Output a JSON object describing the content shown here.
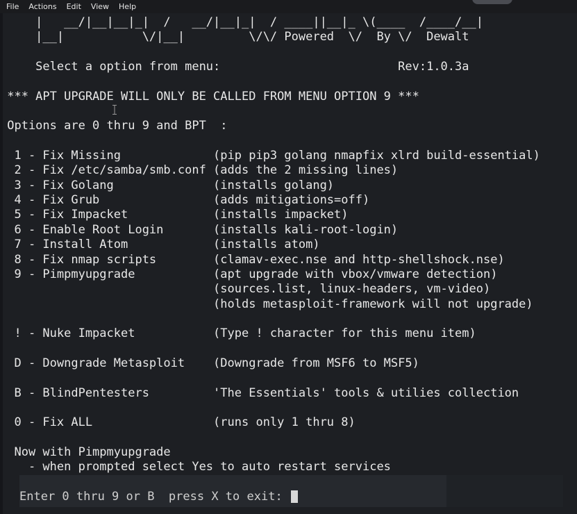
{
  "menubar": {
    "items": [
      {
        "label": "File"
      },
      {
        "label": "Actions"
      },
      {
        "label": "Edit"
      },
      {
        "label": "View"
      },
      {
        "label": "Help"
      }
    ]
  },
  "terminal": {
    "lines": [
      "     |   __/|__|__|_|  /   __/|__|_|  / ____||__|_ \\(____  /____/__|",
      "     |__|           \\/|__|         \\/\\/ Powered  \\/  By \\/  Dewalt",
      "",
      "     Select a option from menu:                         Rev:1.0.3a",
      "",
      " *** APT UPGRADE WILL ONLY BE CALLED FROM MENU OPTION 9 ***",
      "",
      " Options are 0 thru 9 and BPT  :",
      "",
      "  1 - Fix Missing             (pip pip3 golang nmapfix xlrd build-essential)",
      "  2 - Fix /etc/samba/smb.conf (adds the 2 missing lines)",
      "  3 - Fix Golang              (installs golang)",
      "  4 - Fix Grub                (adds mitigations=off)",
      "  5 - Fix Impacket            (installs impacket)",
      "  6 - Enable Root Login       (installs kali-root-login)",
      "  7 - Install Atom            (installs atom)",
      "  8 - Fix nmap scripts        (clamav-exec.nse and http-shellshock.nse)",
      "  9 - Pimpmyupgrade           (apt upgrade with vbox/vmware detection)",
      "                              (sources.list, linux-headers, vm-video)",
      "                              (holds metasploit-framework will not upgrade)",
      "",
      "  ! - Nuke Impacket           (Type ! character for this menu item)",
      "",
      "  D - Downgrade Metasploit    (Downgrade from MSF6 to MSF5)",
      "",
      "  B - BlindPentesters         'The Essentials' tools & utilies collection",
      "",
      "  0 - Fix ALL                 (runs only 1 thru 8)",
      "",
      "  Now with Pimpmyupgrade",
      "    - when prompted select Yes to auto restart services"
    ]
  },
  "prompt": {
    "text": "Enter 0 thru 9 or B  press X to exit: "
  },
  "colors": {
    "background": "#1d1f23",
    "text": "#e8e8e8",
    "menubar": "#1a1b1e",
    "prompt_bar": "#26292e"
  },
  "icons": {
    "mouse": "i-beam-cursor-icon",
    "cursor": "block-cursor-icon"
  }
}
